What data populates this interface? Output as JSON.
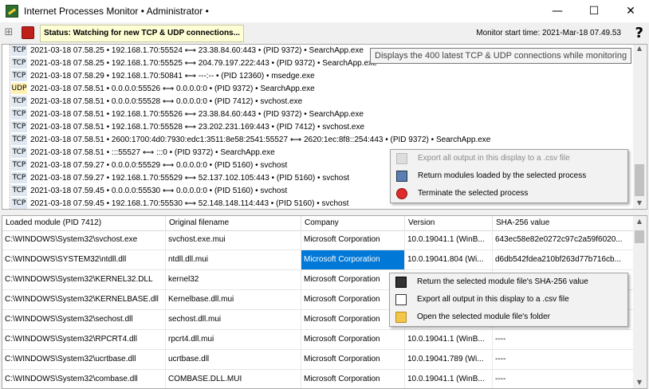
{
  "window": {
    "title": "Internet Processes Monitor • Administrator •",
    "minimize": "—",
    "maximize": "☐",
    "close": "✕"
  },
  "toolbar": {
    "status": "Status: Watching for new TCP & UDP connections...",
    "start_time": "Monitor start time: 2021-Mar-18 07.49.53",
    "help": "?"
  },
  "tooltip": "Displays the 400 latest TCP & UDP connections while monitoring",
  "connections": [
    {
      "proto": "TCP",
      "text": "2021-03-18 07.58.25 • 192.168.1.70:55524 ⟷ 23.38.84.60:443 • (PID 9372) • SearchApp.exe"
    },
    {
      "proto": "TCP",
      "text": "2021-03-18 07.58.25 • 192.168.1.70:55525 ⟷ 204.79.197.222:443 • (PID 9372) • SearchApp.exe"
    },
    {
      "proto": "TCP",
      "text": "2021-03-18 07.58.29 • 192.168.1.70:50841 ⟷ ---:-- • (PID 12360) • msedge.exe"
    },
    {
      "proto": "UDP",
      "text": "2021-03-18 07.58.51 • 0.0.0.0:55526 ⟷ 0.0.0.0:0 • (PID 9372) • SearchApp.exe"
    },
    {
      "proto": "TCP",
      "text": "2021-03-18 07.58.51 • 0.0.0.0:55528 ⟷ 0.0.0.0:0 • (PID 7412) • svchost.exe"
    },
    {
      "proto": "TCP",
      "text": "2021-03-18 07.58.51 • 192.168.1.70:55526 ⟷ 23.38.84.60:443 • (PID 9372) • SearchApp.exe"
    },
    {
      "proto": "TCP",
      "text": "2021-03-18 07.58.51 • 192.168.1.70:55528 ⟷ 23.202.231.169:443 • (PID 7412) • svchost.exe"
    },
    {
      "proto": "TCP",
      "text": "2021-03-18 07.58.51 • 2600:1700:4d0:7930:edc1:3511:8e58:2541:55527 ⟷ 2620:1ec:8f8::254:443 • (PID 9372) • SearchApp.exe"
    },
    {
      "proto": "TCP",
      "text": "2021-03-18 07.58.51 • :::55527 ⟷ :::0 • (PID 9372) • SearchApp.exe"
    },
    {
      "proto": "TCP",
      "text": "2021-03-18 07.59.27 • 0.0.0.0:55529 ⟷ 0.0.0.0:0 • (PID 5160) • svchost"
    },
    {
      "proto": "TCP",
      "text": "2021-03-18 07.59.27 • 192.168.1.70:55529 ⟷ 52.137.102.105:443 • (PID 5160) • svchost"
    },
    {
      "proto": "TCP",
      "text": "2021-03-18 07.59.45 • 0.0.0.0:55530 ⟷ 0.0.0.0:0 • (PID 5160) • svchost"
    },
    {
      "proto": "TCP",
      "text": "2021-03-18 07.59.45 • 192.168.1.70:55530 ⟷ 52.148.148.114:443 • (PID 5160) • svchost"
    }
  ],
  "conn_menu": [
    {
      "label": "Export all output in this display to a .csv file",
      "disabled": true
    },
    {
      "label": "Return modules loaded by the selected process",
      "disabled": false
    },
    {
      "label": "Terminate the selected process",
      "disabled": false
    }
  ],
  "modules": {
    "headers": [
      "Loaded module (PID 7412)",
      "Original filename",
      "Company",
      "Version",
      "SHA-256 value"
    ],
    "rows": [
      [
        "C:\\WINDOWS\\System32\\svchost.exe",
        "svchost.exe.mui",
        "Microsoft Corporation",
        "10.0.19041.1 (WinB...",
        "643ec58e82e0272c97c2a59f6020..."
      ],
      [
        "C:\\WINDOWS\\SYSTEM32\\ntdll.dll",
        "ntdll.dll.mui",
        "Microsoft Corporation",
        "10.0.19041.804 (Wi...",
        "d6db542fdea210bf263d77b716cb..."
      ],
      [
        "C:\\WINDOWS\\System32\\KERNEL32.DLL",
        "kernel32",
        "Microsoft Corporation",
        "",
        ""
      ],
      [
        "C:\\WINDOWS\\System32\\KERNELBASE.dll",
        "Kernelbase.dll.mui",
        "Microsoft Corporation",
        "",
        ""
      ],
      [
        "C:\\WINDOWS\\System32\\sechost.dll",
        "sechost.dll.mui",
        "Microsoft Corporation",
        "",
        ""
      ],
      [
        "C:\\WINDOWS\\System32\\RPCRT4.dll",
        "rpcrt4.dll.mui",
        "Microsoft Corporation",
        "10.0.19041.1 (WinB...",
        "----"
      ],
      [
        "C:\\WINDOWS\\System32\\ucrtbase.dll",
        "ucrtbase.dll",
        "Microsoft Corporation",
        "10.0.19041.789 (Wi...",
        "----"
      ],
      [
        "C:\\WINDOWS\\System32\\combase.dll",
        "COMBASE.DLL.MUI",
        "Microsoft Corporation",
        "10.0.19041.1 (WinB...",
        "----"
      ]
    ]
  },
  "module_menu": [
    {
      "label": "Return the selected module file's SHA-256 value"
    },
    {
      "label": "Export all output in this display to a .csv file"
    },
    {
      "label": "Open the selected module file's folder"
    }
  ]
}
